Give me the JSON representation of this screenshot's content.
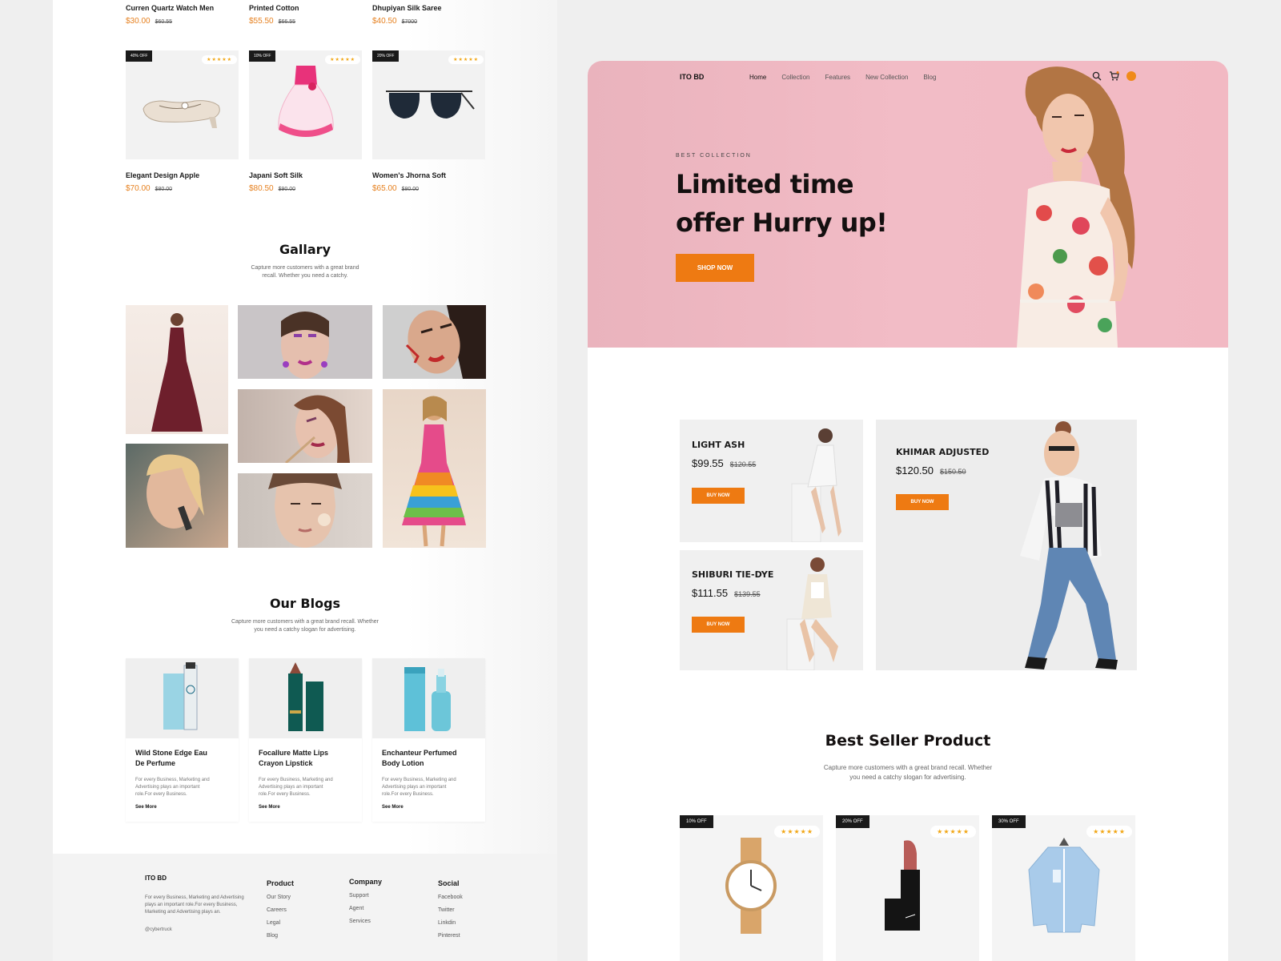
{
  "left_page": {
    "top_products": [
      {
        "name": "Curren Quartz Watch Men",
        "price": "$30.00",
        "old_price": "$60.55"
      },
      {
        "name": "Printed Cotton",
        "price": "$55.50",
        "old_price": "$66.55"
      },
      {
        "name": "Dhupiyan Silk Saree",
        "price": "$40.50",
        "old_price": "$7000"
      }
    ],
    "products": [
      {
        "badge": "40% OFF",
        "stars": "★★★★★",
        "name": "Elegant Design Apple",
        "price": "$70.00",
        "old_price": "$80.00",
        "icon": "shoe-icon"
      },
      {
        "badge": "10% OFF",
        "stars": "★★★★★",
        "name": "Japani Soft Silk",
        "price": "$80.50",
        "old_price": "$90.00",
        "icon": "dress-icon"
      },
      {
        "badge": "20% OFF",
        "stars": "★★★★★",
        "name": "Women's Jhorna Soft",
        "price": "$65.00",
        "old_price": "$80.00",
        "icon": "sunglasses-icon"
      }
    ],
    "gallery": {
      "title": "Gallary",
      "subtitle_line1": "Capture more customers with a great brand",
      "subtitle_line2": "recall. Whether you need a catchy."
    },
    "blogs": {
      "title": "Our Blogs",
      "subtitle_line1": "Capture more customers with a great brand recall. Whether",
      "subtitle_line2": "you need a catchy slogan for advertising.",
      "items": [
        {
          "title_line1": "Wild Stone Edge Eau",
          "title_line2": "De Perfume",
          "desc_line1": "For every Business, Marketing and",
          "desc_line2": "Advertising plays an important",
          "desc_line3": "role.For every Business.",
          "link": "See More",
          "icon": "perfume-bottle-icon"
        },
        {
          "title_line1": "Focallure Matte Lips",
          "title_line2": "Crayon Lipstick",
          "desc_line1": "For every Business, Marketing and",
          "desc_line2": "Advertising plays an important",
          "desc_line3": "role.For every Business.",
          "link": "See More",
          "icon": "lipstick-crayon-icon"
        },
        {
          "title_line1": "Enchanteur Perfumed",
          "title_line2": "Body Lotion",
          "desc_line1": "For every Business, Marketing and",
          "desc_line2": "Advertising plays an important",
          "desc_line3": "role.For every Business.",
          "link": "See More",
          "icon": "lotion-bottle-icon"
        }
      ]
    },
    "footer": {
      "brand": "ITO BD",
      "desc_line1": "For every Business, Marketing and Advertising",
      "desc_line2": "plays an important role.For every Business,",
      "desc_line3": "Marketing and Advertising plays an.",
      "handle": "@cybertruck",
      "product": {
        "heading": "Product",
        "links": [
          "Our Story",
          "Careers",
          "Legal",
          "Blog"
        ]
      },
      "company": {
        "heading": "Company",
        "links": [
          "Support",
          "Agent",
          "Services"
        ]
      },
      "social": {
        "heading": "Social",
        "links": [
          "Facebook",
          "Twitter",
          "Linkdin",
          "Pinterest"
        ]
      }
    }
  },
  "right_page": {
    "nav": {
      "brand": "ITO BD",
      "links": [
        "Home",
        "Collection",
        "Features",
        "New Collection",
        "Blog"
      ],
      "active": "Home"
    },
    "hero": {
      "kicker": "BEST COLLECTION",
      "title_line1": "Limited time",
      "title_line2": "offer Hurry up!",
      "button": "SHOP NOW"
    },
    "featured": [
      {
        "name": "LIGHT ASH",
        "price": "$99.55",
        "old_price": "$120.55",
        "button": "BUY NOW"
      },
      {
        "name": "SHIBURI TIE-DYE",
        "price": "$111.55",
        "old_price": "$139.55",
        "button": "BUY NOW"
      },
      {
        "name": "KHIMAR ADJUSTED",
        "price": "$120.50",
        "old_price": "$150.50",
        "button": "BUY NOW"
      }
    ],
    "best_seller": {
      "title": "Best Seller Product",
      "subtitle_line1": "Capture more customers with a great brand recall. Whether",
      "subtitle_line2": "you need a catchy slogan for advertising.",
      "items": [
        {
          "badge": "10% OFF",
          "stars": "★★★★★",
          "icon": "watch-icon"
        },
        {
          "badge": "20% OFF",
          "stars": "★★★★★",
          "icon": "lipstick-icon"
        },
        {
          "badge": "30% OFF",
          "stars": "★★★★★",
          "icon": "shirt-icon"
        }
      ]
    }
  },
  "colors": {
    "accent": "#ee7a12",
    "price": "#e6801f",
    "hero_bg": "#f2bcc6",
    "badge": "#1a1a1a",
    "star": "#f1a512"
  }
}
